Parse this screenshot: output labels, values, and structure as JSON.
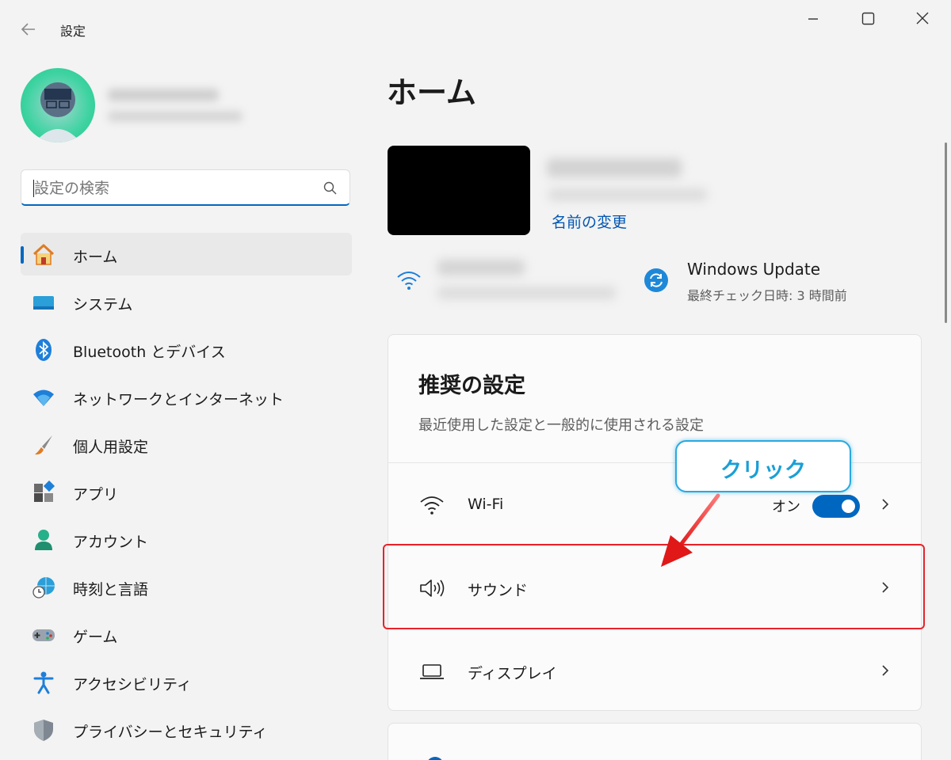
{
  "window": {
    "title": "設定",
    "back_icon": "back-arrow-icon",
    "controls": [
      "minimize-icon",
      "maximize-icon",
      "close-icon"
    ]
  },
  "sidebar": {
    "search_placeholder": "設定の検索",
    "items": [
      {
        "label": "ホーム",
        "icon": "home-icon",
        "selected": true
      },
      {
        "label": "システム",
        "icon": "system-icon"
      },
      {
        "label": "Bluetooth とデバイス",
        "icon": "bluetooth-icon"
      },
      {
        "label": "ネットワークとインターネット",
        "icon": "network-icon"
      },
      {
        "label": "個人用設定",
        "icon": "paintbrush-icon"
      },
      {
        "label": "アプリ",
        "icon": "apps-icon"
      },
      {
        "label": "アカウント",
        "icon": "account-icon"
      },
      {
        "label": "時刻と言語",
        "icon": "time-language-icon"
      },
      {
        "label": "ゲーム",
        "icon": "gamepad-icon"
      },
      {
        "label": "アクセシビリティ",
        "icon": "accessibility-icon"
      },
      {
        "label": "プライバシーとセキュリティ",
        "icon": "shield-icon"
      }
    ]
  },
  "main": {
    "title": "ホーム",
    "rename_link": "名前の変更",
    "update": {
      "title": "Windows Update",
      "subtitle": "最終チェック日時: 3 時間前"
    },
    "recommended": {
      "title": "推奨の設定",
      "subtitle": "最近使用した設定と一般的に使用される設定",
      "rows": [
        {
          "label": "Wi-Fi",
          "icon": "wifi-icon",
          "toggle_label": "オン",
          "toggle_on": true
        },
        {
          "label": "サウンド",
          "icon": "speaker-icon"
        },
        {
          "label": "ディスプレイ",
          "icon": "laptop-icon"
        }
      ]
    }
  },
  "annotation": {
    "callout_text": "クリック",
    "highlight_color": "#e8232a",
    "callout_color": "#29a9e0"
  },
  "colors": {
    "accent": "#0067c0",
    "background": "#f3f3f3"
  }
}
